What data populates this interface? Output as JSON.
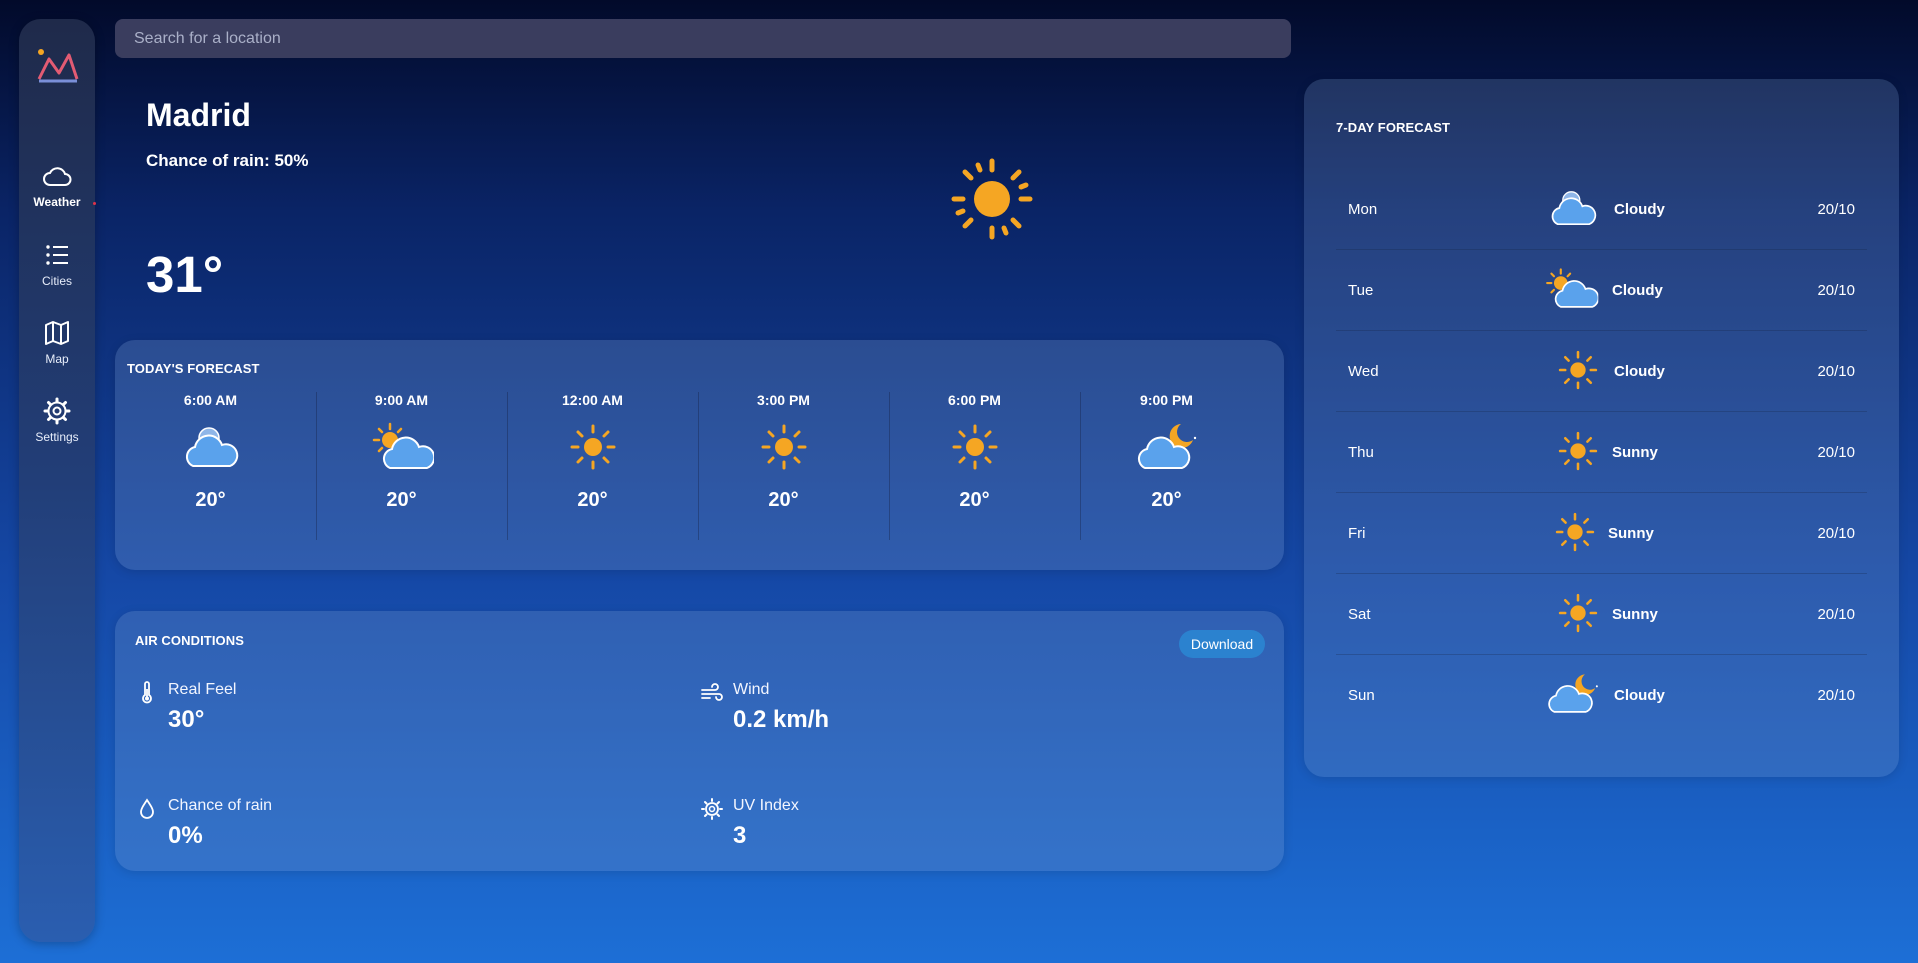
{
  "sidebar": {
    "items": [
      {
        "label": "Weather",
        "icon": "cloud-icon"
      },
      {
        "label": "Cities",
        "icon": "list-icon"
      },
      {
        "label": "Map",
        "icon": "map-icon"
      },
      {
        "label": "Settings",
        "icon": "gear-icon"
      }
    ]
  },
  "search": {
    "placeholder": "Search for a location",
    "value": ""
  },
  "current": {
    "city": "Madrid",
    "chance_of_rain": "Chance of rain: 50%",
    "temperature": "31°",
    "icon": "sun-icon"
  },
  "today": {
    "title": "TODAY'S FORECAST",
    "hours": [
      {
        "time": "6:00 AM",
        "icon": "cloudy-icon",
        "temp": "20°"
      },
      {
        "time": "9:00 AM",
        "icon": "partly-sunny-icon",
        "temp": "20°"
      },
      {
        "time": "12:00 AM",
        "icon": "sun-icon",
        "temp": "20°"
      },
      {
        "time": "3:00 PM",
        "icon": "sun-icon",
        "temp": "20°"
      },
      {
        "time": "6:00 PM",
        "icon": "sun-icon",
        "temp": "20°"
      },
      {
        "time": "9:00 PM",
        "icon": "night-cloudy-icon",
        "temp": "20°"
      }
    ]
  },
  "air": {
    "title": "AIR CONDITIONS",
    "download_label": "Download",
    "conditions": [
      {
        "label": "Real Feel",
        "value": "30°",
        "icon": "thermometer-icon"
      },
      {
        "label": "Wind",
        "value": "0.2 km/h",
        "icon": "wind-icon"
      },
      {
        "label": "Chance of rain",
        "value": "0%",
        "icon": "droplet-icon"
      },
      {
        "label": "UV Index",
        "value": "3",
        "icon": "uv-sun-icon"
      }
    ]
  },
  "week": {
    "title": "7-DAY FORECAST",
    "days": [
      {
        "day": "Mon",
        "icon": "cloudy-icon",
        "desc": "Cloudy",
        "range": "20/10"
      },
      {
        "day": "Tue",
        "icon": "partly-sunny-icon",
        "desc": "Cloudy",
        "range": "20/10"
      },
      {
        "day": "Wed",
        "icon": "sun-icon",
        "desc": "Cloudy",
        "range": "20/10"
      },
      {
        "day": "Thu",
        "icon": "sun-icon",
        "desc": "Sunny",
        "range": "20/10"
      },
      {
        "day": "Fri",
        "icon": "sun-icon",
        "desc": "Sunny",
        "range": "20/10"
      },
      {
        "day": "Sat",
        "icon": "sun-icon",
        "desc": "Sunny",
        "range": "20/10"
      },
      {
        "day": "Sun",
        "icon": "night-cloudy-icon",
        "desc": "Cloudy",
        "range": "20/10"
      }
    ]
  },
  "colors": {
    "accent": "#2b82cf",
    "sun": "#f5a623",
    "cloud": "#5aa2ec"
  }
}
